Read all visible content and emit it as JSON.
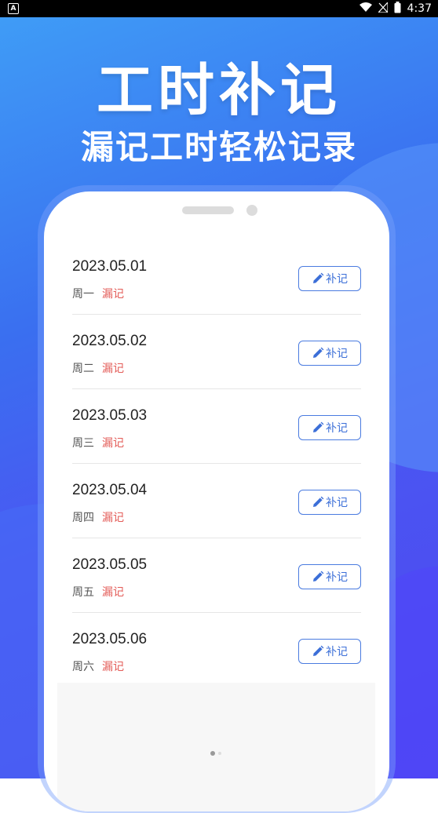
{
  "status_bar": {
    "left_icon": "A",
    "time": "4:37",
    "icons": [
      "wifi-icon",
      "signal-icon",
      "battery-icon"
    ]
  },
  "hero": {
    "title": "工时补记",
    "subtitle": "漏记工时轻松记录"
  },
  "list": {
    "items": [
      {
        "date": "2023.05.01",
        "weekday": "周一",
        "status": "漏记",
        "button": "补记"
      },
      {
        "date": "2023.05.02",
        "weekday": "周二",
        "status": "漏记",
        "button": "补记"
      },
      {
        "date": "2023.05.03",
        "weekday": "周三",
        "status": "漏记",
        "button": "补记"
      },
      {
        "date": "2023.05.04",
        "weekday": "周四",
        "status": "漏记",
        "button": "补记"
      },
      {
        "date": "2023.05.05",
        "weekday": "周五",
        "status": "漏记",
        "button": "补记"
      },
      {
        "date": "2023.05.06",
        "weekday": "周六",
        "status": "漏记",
        "button": "补记"
      }
    ]
  },
  "colors": {
    "accent": "#3c6fd8",
    "status_red": "#e35b57",
    "bg_top": "#3f9cf6",
    "bg_bottom": "#4e45f0"
  }
}
